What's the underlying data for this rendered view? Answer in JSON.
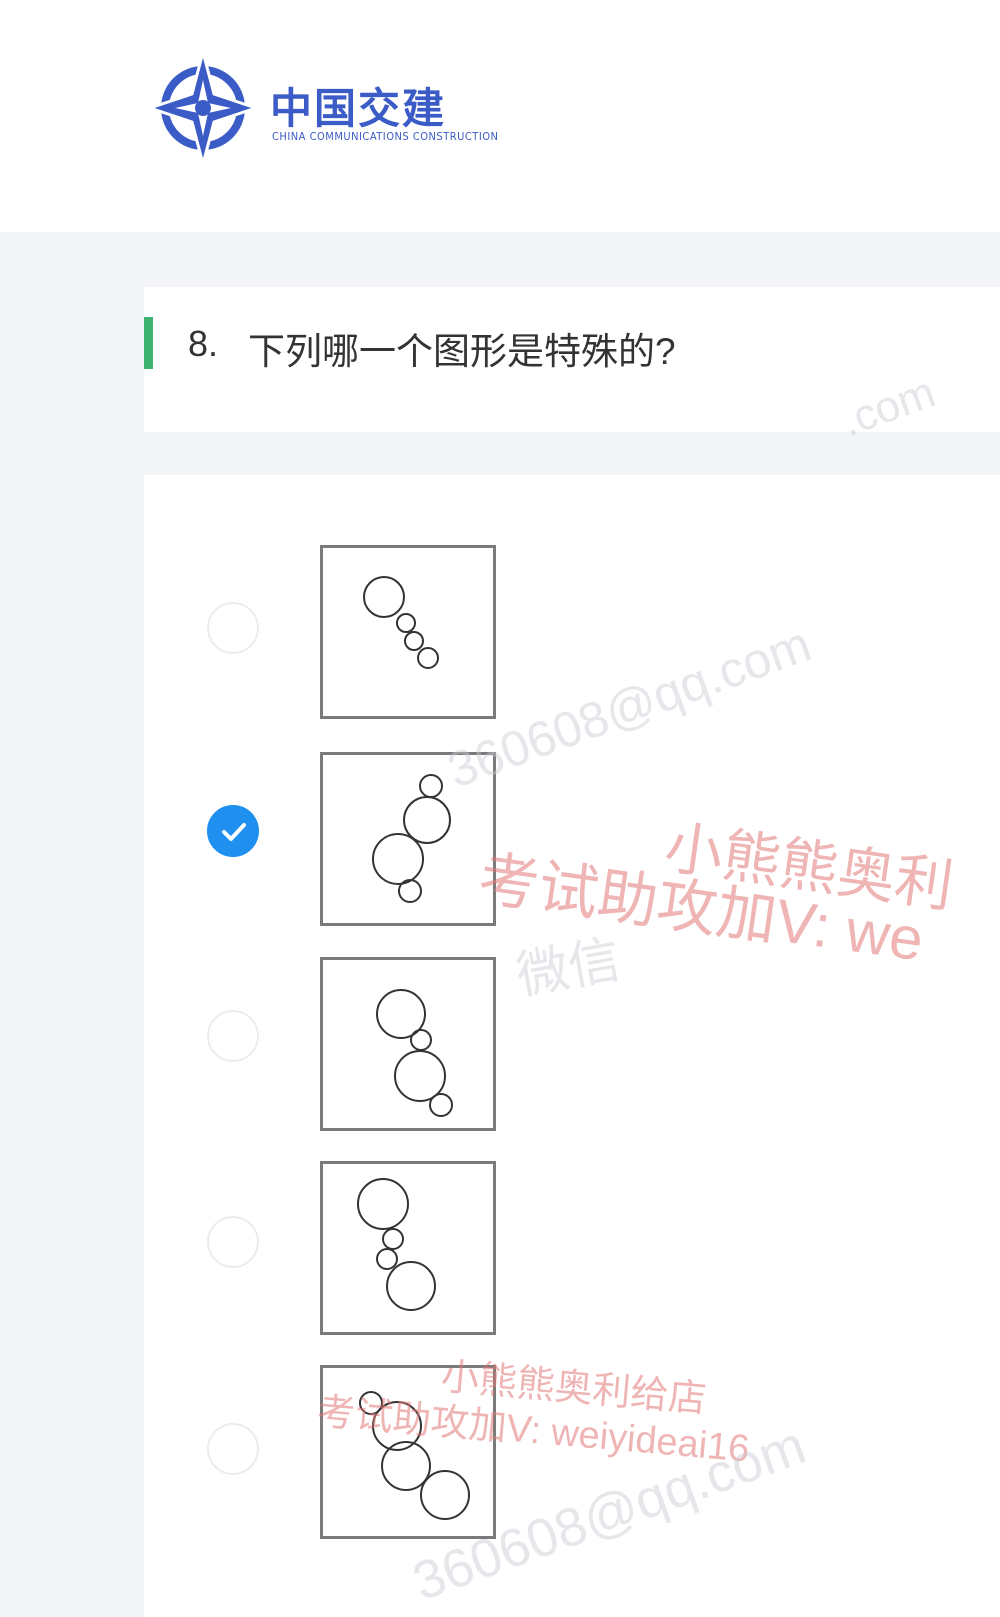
{
  "header": {
    "logo_cn": "中国交建",
    "logo_en": "CHINA COMMUNICATIONS CONSTRUCTION",
    "logo_color": "#3b5bc6"
  },
  "question": {
    "number": "8.",
    "text": "下列哪一个图形是特殊的?",
    "accent_color": "#3eb371"
  },
  "options": [
    {
      "figure": "circles-figure-1",
      "selected": false
    },
    {
      "figure": "circles-figure-2",
      "selected": true
    },
    {
      "figure": "circles-figure-3",
      "selected": false
    },
    {
      "figure": "circles-figure-4",
      "selected": false
    },
    {
      "figure": "circles-figure-5",
      "selected": false
    }
  ],
  "selection_color": "#1f8ff0",
  "watermarks": {
    "shop_name": "小熊熊奥利",
    "exam_help": "考试助攻加V: we",
    "shop_name_full": "小熊熊奥利给店",
    "exam_help_full": "考试助攻加V: weiyideai16",
    "email_1": "360608@qq.com",
    "email_2": "360608@qq.com",
    "faint_1": "微信",
    "faint_2": ".com"
  }
}
